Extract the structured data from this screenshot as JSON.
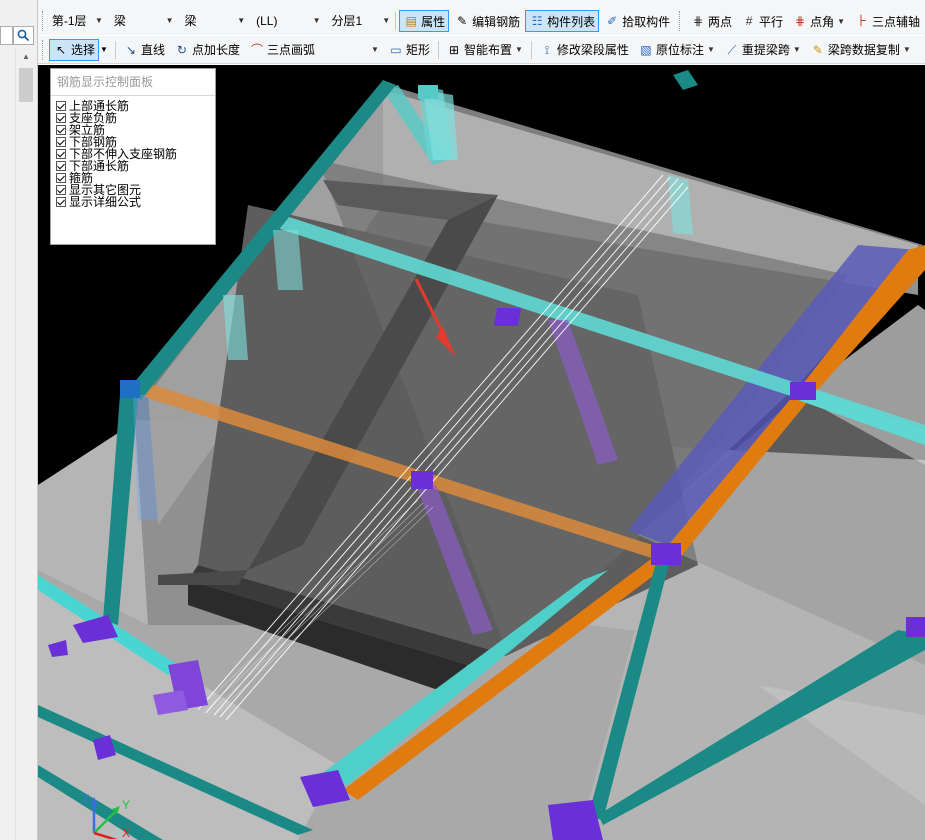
{
  "toolbar1": {
    "floor_combo": "第-1层",
    "type_combo": "梁",
    "subtype_combo": "梁",
    "member_combo": "(LL)",
    "layer_combo": "分层1",
    "btn_properties": "属性",
    "btn_edit_rebar": "编辑钢筋",
    "btn_member_list": "构件列表",
    "btn_pick_member": "拾取构件",
    "btn_two_points": "两点",
    "btn_parallel": "平行",
    "btn_point_angle": "点角",
    "btn_three_point_axis": "三点辅轴"
  },
  "toolbar2": {
    "btn_select": "选择",
    "btn_line": "直线",
    "btn_point_length": "点加长度",
    "btn_three_point_arc": "三点画弧",
    "btn_rectangle": "矩形",
    "btn_smart_layout": "智能布置",
    "btn_modify_span": "修改梁段属性",
    "btn_in_situ_label": "原位标注",
    "btn_re_extract_span": "重提梁跨",
    "btn_span_copy": "梁跨数据复制"
  },
  "rebar_panel": {
    "title": "钢筋显示控制面板",
    "items": [
      "上部通长筋",
      "支座负筋",
      "架立筋",
      "下部钢筋",
      "下部不伸入支座钢筋",
      "下部通长筋",
      "箍筋",
      "显示其它图元",
      "显示详细公式"
    ]
  },
  "axes": {
    "z": "Z",
    "y": "Y",
    "x": "X"
  },
  "colors": {
    "teal_beam": "#1b8a86",
    "cyan_beam": "#5fd8d3",
    "orange_beam": "#e07b10",
    "purple_column": "#6a2fd6",
    "slab_gray": "#9a9a9a",
    "arrow_red": "#e23b2e"
  }
}
